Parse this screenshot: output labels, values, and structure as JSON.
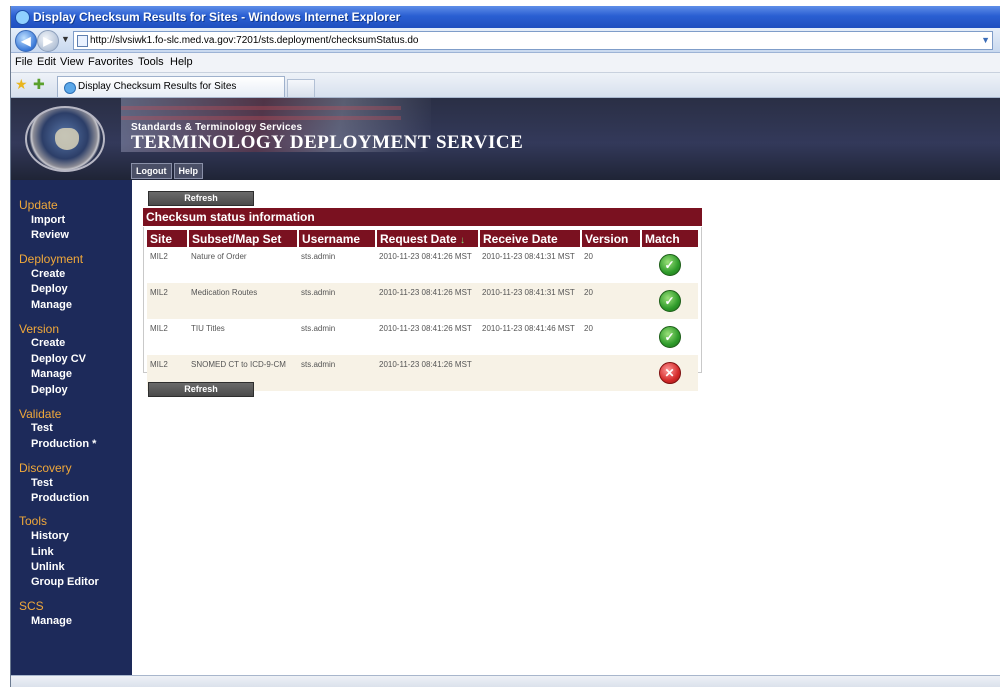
{
  "window": {
    "title": "Display Checksum Results for Sites - Windows Internet Explorer"
  },
  "address_bar": {
    "url": "http://slvsiwk1.fo-slc.med.va.gov:7201/sts.deployment/checksumStatus.do"
  },
  "menu": {
    "items": [
      "File",
      "Edit",
      "View",
      "Favorites",
      "Tools",
      "Help"
    ]
  },
  "tab": {
    "label": "Display Checksum Results for Sites"
  },
  "banner": {
    "subtitle": "Standards & Terminology Services",
    "title": "TERMINOLOGY DEPLOYMENT SERVICE",
    "buttons": [
      "Logout",
      "Help"
    ]
  },
  "sidebar": {
    "groups": [
      {
        "label": "Update",
        "items": [
          "Import",
          "Review"
        ]
      },
      {
        "label": "Deployment",
        "items": [
          "Create",
          "Deploy",
          "Manage"
        ]
      },
      {
        "label": "Version",
        "items": [
          "Create",
          "Deploy CV",
          "Manage",
          "Deploy"
        ]
      },
      {
        "label": "Validate",
        "items": [
          "Test",
          "Production *"
        ]
      },
      {
        "label": "Discovery",
        "items": [
          "Test",
          "Production"
        ]
      },
      {
        "label": "Tools",
        "items": [
          "History",
          "Link",
          "Unlink",
          "Group Editor"
        ]
      },
      {
        "label": "SCS",
        "items": [
          "Manage"
        ]
      }
    ]
  },
  "content": {
    "refresh_label": "Refresh",
    "section_title": "Checksum status information",
    "columns": [
      "Site",
      "Subset/Map Set",
      "Username",
      "Request Date",
      "Receive Date",
      "Version",
      "Match"
    ],
    "sort_indicator": "↓",
    "rows": [
      {
        "site": "MIL2",
        "subset": "Nature of Order",
        "username": "sts.admin",
        "request_date": "2010-11-23 08:41:26 MST",
        "receive_date": "2010-11-23 08:41:31 MST",
        "version": "20",
        "match": "ok"
      },
      {
        "site": "MIL2",
        "subset": "Medication Routes",
        "username": "sts.admin",
        "request_date": "2010-11-23 08:41:26 MST",
        "receive_date": "2010-11-23 08:41:31 MST",
        "version": "20",
        "match": "ok"
      },
      {
        "site": "MIL2",
        "subset": "TIU Titles",
        "username": "sts.admin",
        "request_date": "2010-11-23 08:41:26 MST",
        "receive_date": "2010-11-23 08:41:46 MST",
        "version": "20",
        "match": "ok"
      },
      {
        "site": "MIL2",
        "subset": "SNOMED CT to ICD-9-CM",
        "username": "sts.admin",
        "request_date": "2010-11-23 08:41:26 MST",
        "receive_date": "",
        "version": "",
        "match": "fail"
      }
    ],
    "icons": {
      "match_ok": "check-circle-icon",
      "match_fail": "x-circle-icon"
    }
  },
  "colors": {
    "header_bar": "#7a1120",
    "sidebar_bg": "#1d2a5a",
    "sidebar_group": "#f0a83a",
    "row_alt": "#f7f2e6"
  }
}
